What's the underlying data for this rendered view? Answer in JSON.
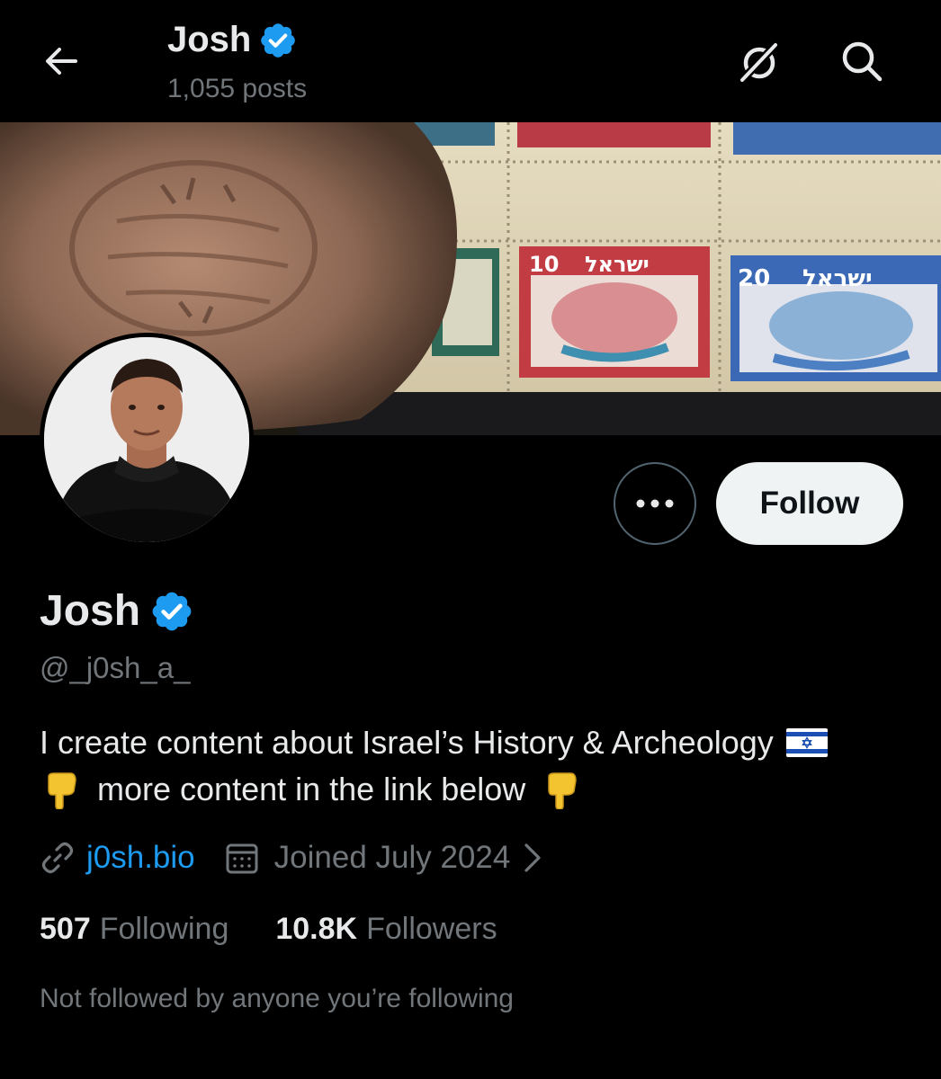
{
  "header": {
    "name": "Josh",
    "posts": "1,055 posts",
    "icons": {
      "back": "arrow-left-icon",
      "grok": "grok-icon",
      "search": "search-icon",
      "verified": "verified-badge-icon"
    }
  },
  "banner": {
    "description_icon": "banner-image",
    "stamps": [
      {
        "value": "10",
        "text": "ישראל"
      },
      {
        "value": "20",
        "text": "ישראל"
      }
    ]
  },
  "profile": {
    "name": "Josh",
    "handle": "@_j0sh_a_",
    "bio_line1": "I create content about Israel’s History & Archeology",
    "bio_line2": "more content in the link below",
    "link": "j0sh.bio",
    "joined": "Joined July 2024",
    "following_count": "507",
    "following_label": "Following",
    "followers_count": "10.8K",
    "followers_label": "Followers",
    "not_followed": "Not followed by anyone you’re following"
  },
  "actions": {
    "follow_label": "Follow",
    "more_icon": "more-horizontal-icon"
  },
  "colors": {
    "background": "#000000",
    "text": "#e7e9ea",
    "secondary": "#71767b",
    "accent": "#1d9bf0",
    "follow_bg": "#eff3f4"
  }
}
